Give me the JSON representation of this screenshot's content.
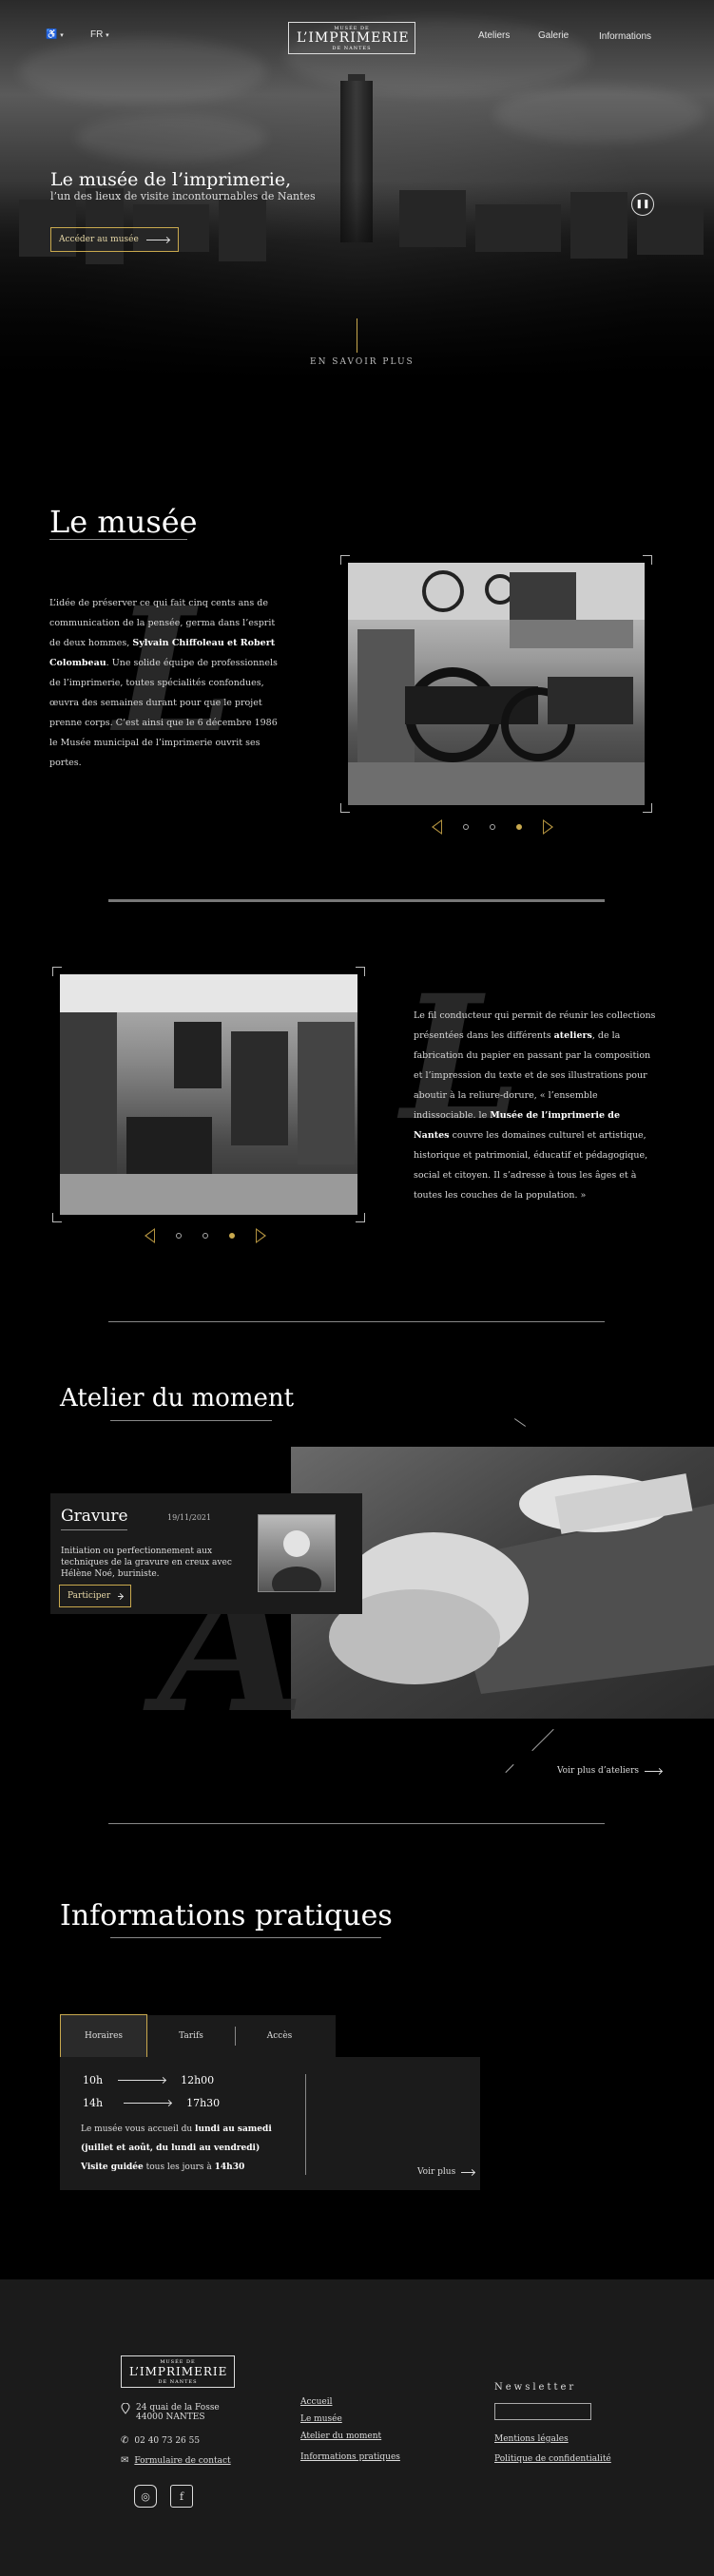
{
  "header": {
    "accessibility": "♿",
    "accessibility_caret": "▾",
    "language": "FR",
    "language_caret": "▾",
    "logo_top": "MUSÉE DE",
    "logo_main": "L’IMPRIMERIE",
    "logo_bottom": "DE NANTES",
    "nav": [
      "Ateliers",
      "Galerie",
      "Informations"
    ]
  },
  "hero": {
    "title": "Le musée de l’imprimerie,",
    "subtitle": "l’un des lieux de visite incontournables de Nantes",
    "cta_label": "Accéder au musée",
    "pause_label": "❚❚",
    "know_more": "EN SAVOIR PLUS"
  },
  "musee": {
    "title": "Le musée",
    "drop_letter": "L",
    "p1": "L’idée de préserver ce qui fait cinq cents ans de communication de la pensée, germa dans l’esprit de deux hommes,",
    "p1_bold": "Sylvain Chiffoleau et Robert Colombeau",
    "p1_rest": ". Une solide équipe de professionnels de l’imprimerie, toutes spécialités confondues, œuvra des semaines durant pour que le projet prenne corps. C’est ainsi que le 6 décembre 1986 le Musée municipal de l’imprimerie ouvrit ses portes.",
    "second_drop_letter": "L",
    "p2a": "Le fil conducteur qui permit de réunir les collections présentées dans les différents",
    "p2_bold1": "ateliers",
    "p2b": ", de la fabrication du papier en passant par la composition et l’impression du texte et de ses illustrations pour aboutir à la reliure-dorure, « l’ensemble indissociable. le",
    "p2_bold2": "Musée de l’imprimerie de Nantes",
    "p2c": "couvre les domaines culturel et artistique, historique et patrimonial, éducatif et pédagogique, social et citoyen. Il s’adresse à tous les âges et à toutes les couches de la population. »"
  },
  "atelier": {
    "title": "Atelier du moment",
    "drop_letter": "A",
    "card_title": "Gravure",
    "card_date": "19/11/2021",
    "card_desc": "Initiation ou perfectionnement aux techniques de la gravure en creux avec Hélène Noé, buriniste.",
    "card_cta": "Participer",
    "more_link": "Voir plus d’ateliers"
  },
  "infos": {
    "title": "Informations pratiques",
    "tabs": [
      "Horaires",
      "Tarifs",
      "Accès"
    ],
    "hours": [
      {
        "from": "10h",
        "to": "12h00"
      },
      {
        "from": "14h",
        "to": "17h30"
      }
    ],
    "line1_a": "Le musée vous accueil du",
    "line1_b": "lundi au samedi",
    "line2": "(juillet et août, du lundi au vendredi)",
    "line3_a": "Visite guidée",
    "line3_b": "tous les jours à",
    "line3_c": "14h30",
    "more": "Voir plus"
  },
  "footer": {
    "logo_top": "MUSÉE DE",
    "logo_main": "L’IMPRIMERIE",
    "logo_bottom": "DE NANTES",
    "address1": "24 quai de la Fosse",
    "address2": "44000 NANTES",
    "phone": "02 40 73 26 55",
    "contact": "Formulaire de contact",
    "links": [
      "Accueil",
      "Le musée",
      "Atelier du moment",
      "Informations pratiques"
    ],
    "newsletter": "Newsletter",
    "legal": [
      "Mentions légales",
      "Politique de confidentialité"
    ],
    "social_icons": [
      "instagram-icon",
      "facebook-icon"
    ],
    "instagram_glyph": "◎",
    "facebook_glyph": "f"
  },
  "colors": {
    "gold": "#c9a94e",
    "background": "#000000",
    "panel": "#1b1b1b"
  }
}
